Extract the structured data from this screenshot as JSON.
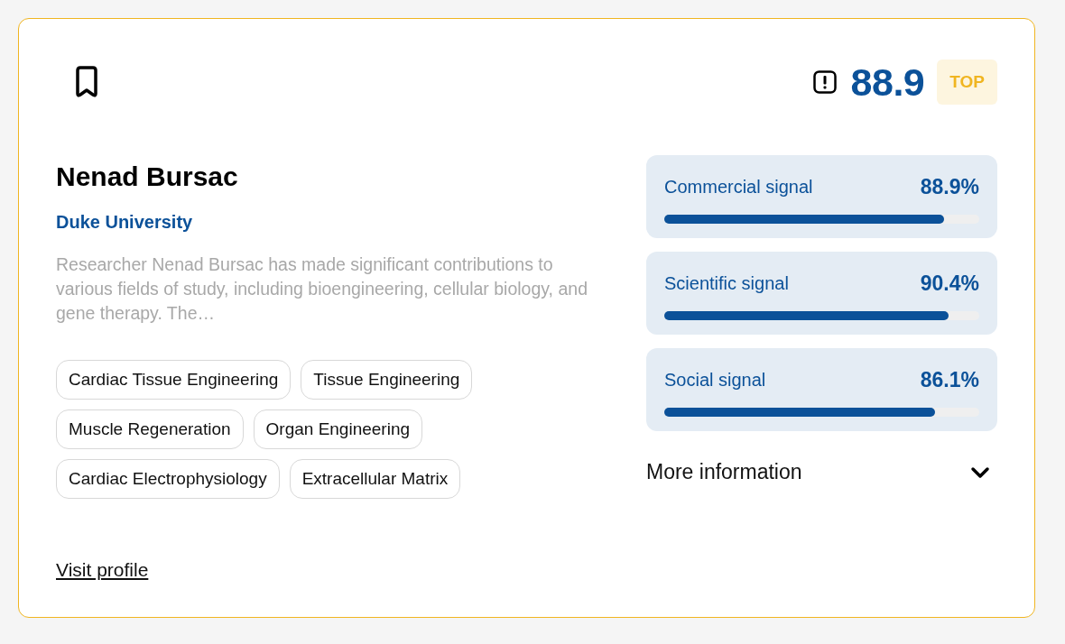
{
  "card": {
    "bookmarked": false,
    "score": "88.9",
    "badge": "TOP",
    "name": "Nenad Bursac",
    "institution": "Duke University",
    "description": "Researcher Nenad Bursac has made significant contributions to various fields of study, including bioengineering, cellular biology, and gene therapy. The…",
    "tags": [
      "Cardiac Tissue Engineering",
      "Tissue Engineering",
      "Muscle Regeneration",
      "Organ Engineering",
      "Cardiac Electrophysiology",
      "Extracellular Matrix"
    ],
    "link": "Visit profile",
    "signals": [
      {
        "label": "Commercial signal",
        "reading": "88.9%",
        "level": 0.889
      },
      {
        "label": "Scientific signal",
        "reading": "90.4%",
        "level": 0.904
      },
      {
        "label": "Social signal",
        "reading": "86.1%",
        "level": 0.861
      }
    ],
    "more": {
      "label": "More information",
      "expanded": false
    }
  }
}
